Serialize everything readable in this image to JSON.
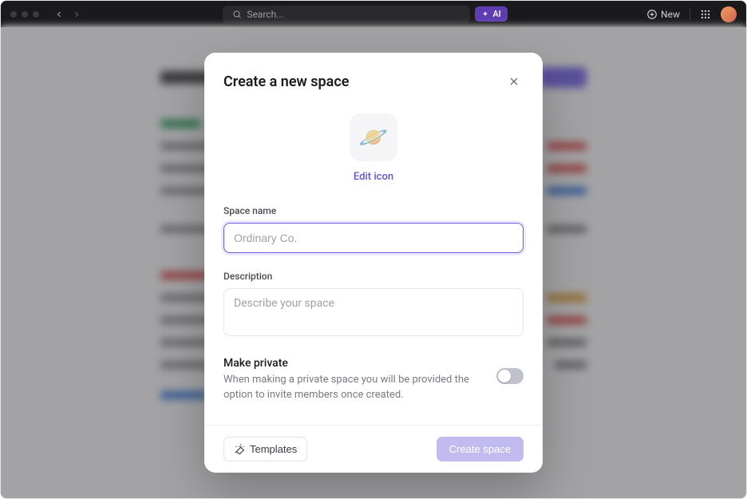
{
  "topbar": {
    "search_placeholder": "Search...",
    "ai_label": "AI",
    "new_label": "New"
  },
  "modal": {
    "title": "Create a new space",
    "icon_emoji": "🪐",
    "edit_icon_label": "Edit icon",
    "space_name_label": "Space name",
    "space_name_placeholder": "Ordinary Co.",
    "description_label": "Description",
    "description_placeholder": "Describe your space",
    "make_private_title": "Make private",
    "make_private_desc": "When making a private space you will be provided the option to invite members once created.",
    "templates_label": "Templates",
    "create_label": "Create space"
  }
}
